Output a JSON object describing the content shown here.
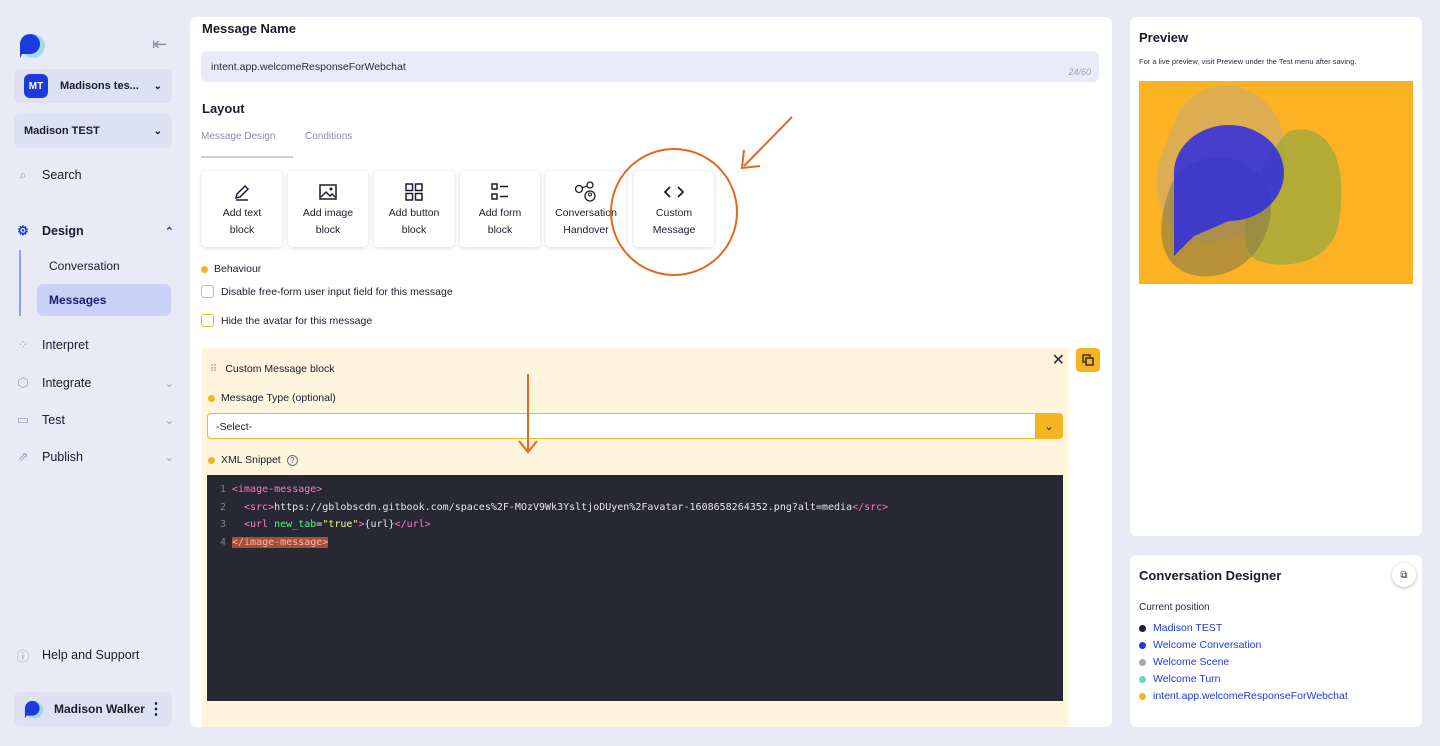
{
  "sidebar": {
    "workspace": {
      "badge": "MT",
      "name": "Madisons tes..."
    },
    "project": "Madison TEST",
    "nav": {
      "search": "Search",
      "design": "Design",
      "conversation": "Conversation",
      "messages": "Messages",
      "interpret": "Interpret",
      "integrate": "Integrate",
      "test": "Test",
      "publish": "Publish",
      "help": "Help and Support"
    },
    "user": "Madison Walker"
  },
  "main": {
    "message_name_label": "Message Name",
    "message_name_value": "intent.app.welcomeResponseForWebchat",
    "message_name_count": "24/60",
    "layout_label": "Layout",
    "tabs": [
      "Message Design",
      "Conditions"
    ],
    "blocks": [
      {
        "line1": "Add text",
        "line2": "block",
        "icon": "pencil-icon"
      },
      {
        "line1": "Add image",
        "line2": "block",
        "icon": "image-icon"
      },
      {
        "line1": "Add button",
        "line2": "block",
        "icon": "grid-icon"
      },
      {
        "line1": "Add form",
        "line2": "block",
        "icon": "form-list-icon"
      },
      {
        "line1": "Conversation",
        "line2": "Handover",
        "icon": "handover-icon"
      },
      {
        "line1": "Custom",
        "line2": "Message",
        "icon": "code-icon"
      }
    ],
    "behaviour_label": "Behaviour",
    "check_disable_input": "Disable free-form user input field for this message",
    "check_hide_avatar": "Hide the avatar for this message",
    "custom_block": {
      "title": "Custom Message block",
      "message_type_label": "Message Type (optional)",
      "select_value": "-Select-",
      "xml_label": "XML Snippet",
      "code_lines": {
        "l1": {
          "num": "1",
          "open": "<image-message>"
        },
        "l2": {
          "num": "2",
          "open": "<src>",
          "text": "https://gblobscdn.gitbook.com/spaces%2F-MOzV9Wk3YsltjoDUyen%2Favatar-1608658264352.png?alt=media",
          "close": "</src>"
        },
        "l3": {
          "num": "3",
          "open": "<url",
          "attr": "new_tab",
          "eq": "=",
          "val": "\"true\"",
          "gt": ">",
          "text": "{url}",
          "close": "</url>"
        },
        "l4": {
          "num": "4",
          "close": "</image-message>"
        }
      }
    }
  },
  "preview": {
    "title": "Preview",
    "subtitle": "For a live preview, visit Preview under the Test menu after saving."
  },
  "designer": {
    "title": "Conversation Designer",
    "current_label": "Current position",
    "items": [
      {
        "label": "Madison TEST",
        "color": "#1b1b3a"
      },
      {
        "label": "Welcome Conversation",
        "color": "#1d3bdb"
      },
      {
        "label": "Welcome Scene",
        "color": "#a3a6b4"
      },
      {
        "label": "Welcome Turn",
        "color": "#6fd3c2"
      },
      {
        "label": "intent.app.welcomeResponseForWebchat",
        "color": "#f5b522"
      }
    ]
  },
  "colors": {
    "accent": "#f5b522",
    "brand": "#1d3bdb",
    "annotation": "#e3681f"
  }
}
